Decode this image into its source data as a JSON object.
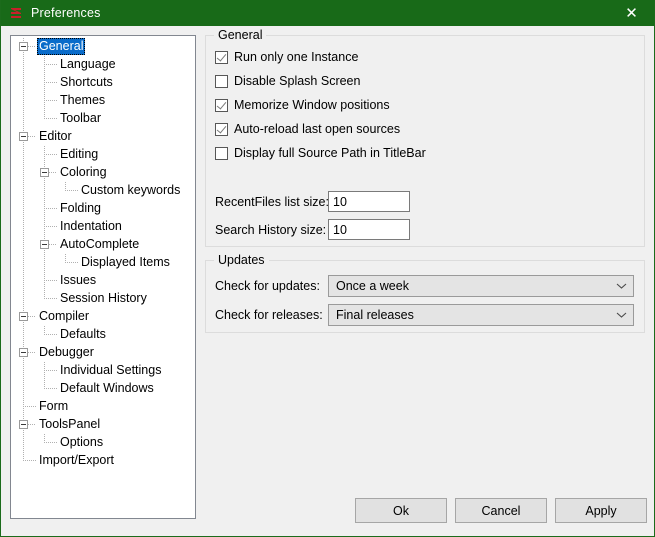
{
  "window": {
    "title": "Preferences",
    "icon": "purebasic-logo-icon",
    "close_label": "✕",
    "titlebar_color": "#186a18",
    "accent_color": "#0a6cca",
    "dialog_background": "#f0f0f0"
  },
  "tree": {
    "selected": "General",
    "items": [
      {
        "label": "General",
        "depth": 0,
        "expander": true
      },
      {
        "label": "Language",
        "depth": 1,
        "expander": false
      },
      {
        "label": "Shortcuts",
        "depth": 1,
        "expander": false
      },
      {
        "label": "Themes",
        "depth": 1,
        "expander": false
      },
      {
        "label": "Toolbar",
        "depth": 1,
        "expander": false
      },
      {
        "label": "Editor",
        "depth": 0,
        "expander": true
      },
      {
        "label": "Editing",
        "depth": 1,
        "expander": false
      },
      {
        "label": "Coloring",
        "depth": 1,
        "expander": true
      },
      {
        "label": "Custom keywords",
        "depth": 2,
        "expander": false
      },
      {
        "label": "Folding",
        "depth": 1,
        "expander": false
      },
      {
        "label": "Indentation",
        "depth": 1,
        "expander": false
      },
      {
        "label": "AutoComplete",
        "depth": 1,
        "expander": true
      },
      {
        "label": "Displayed Items",
        "depth": 2,
        "expander": false
      },
      {
        "label": "Issues",
        "depth": 1,
        "expander": false
      },
      {
        "label": "Session History",
        "depth": 1,
        "expander": false
      },
      {
        "label": "Compiler",
        "depth": 0,
        "expander": true
      },
      {
        "label": "Defaults",
        "depth": 1,
        "expander": false
      },
      {
        "label": "Debugger",
        "depth": 0,
        "expander": true
      },
      {
        "label": "Individual Settings",
        "depth": 1,
        "expander": false
      },
      {
        "label": "Default Windows",
        "depth": 1,
        "expander": false
      },
      {
        "label": "Form",
        "depth": 0,
        "expander": false
      },
      {
        "label": "ToolsPanel",
        "depth": 0,
        "expander": true
      },
      {
        "label": "Options",
        "depth": 1,
        "expander": false
      },
      {
        "label": "Import/Export",
        "depth": 0,
        "expander": false
      }
    ]
  },
  "general_group": {
    "title": "General",
    "checkboxes": [
      {
        "label": "Run only one Instance",
        "checked": true
      },
      {
        "label": "Disable Splash Screen",
        "checked": false
      },
      {
        "label": "Memorize Window positions",
        "checked": true
      },
      {
        "label": "Auto-reload last open sources",
        "checked": true
      },
      {
        "label": "Display full Source Path in TitleBar",
        "checked": false
      }
    ],
    "fields": [
      {
        "label": "RecentFiles list size:",
        "value": "10"
      },
      {
        "label": "Search History size:",
        "value": "10"
      }
    ]
  },
  "updates_group": {
    "title": "Updates",
    "combos": [
      {
        "label": "Check for updates:",
        "value": "Once a week",
        "icon": "chevron-down-icon"
      },
      {
        "label": "Check for releases:",
        "value": "Final releases",
        "icon": "chevron-down-icon"
      }
    ]
  },
  "footer": {
    "ok_label": "Ok",
    "cancel_label": "Cancel",
    "apply_label": "Apply"
  }
}
